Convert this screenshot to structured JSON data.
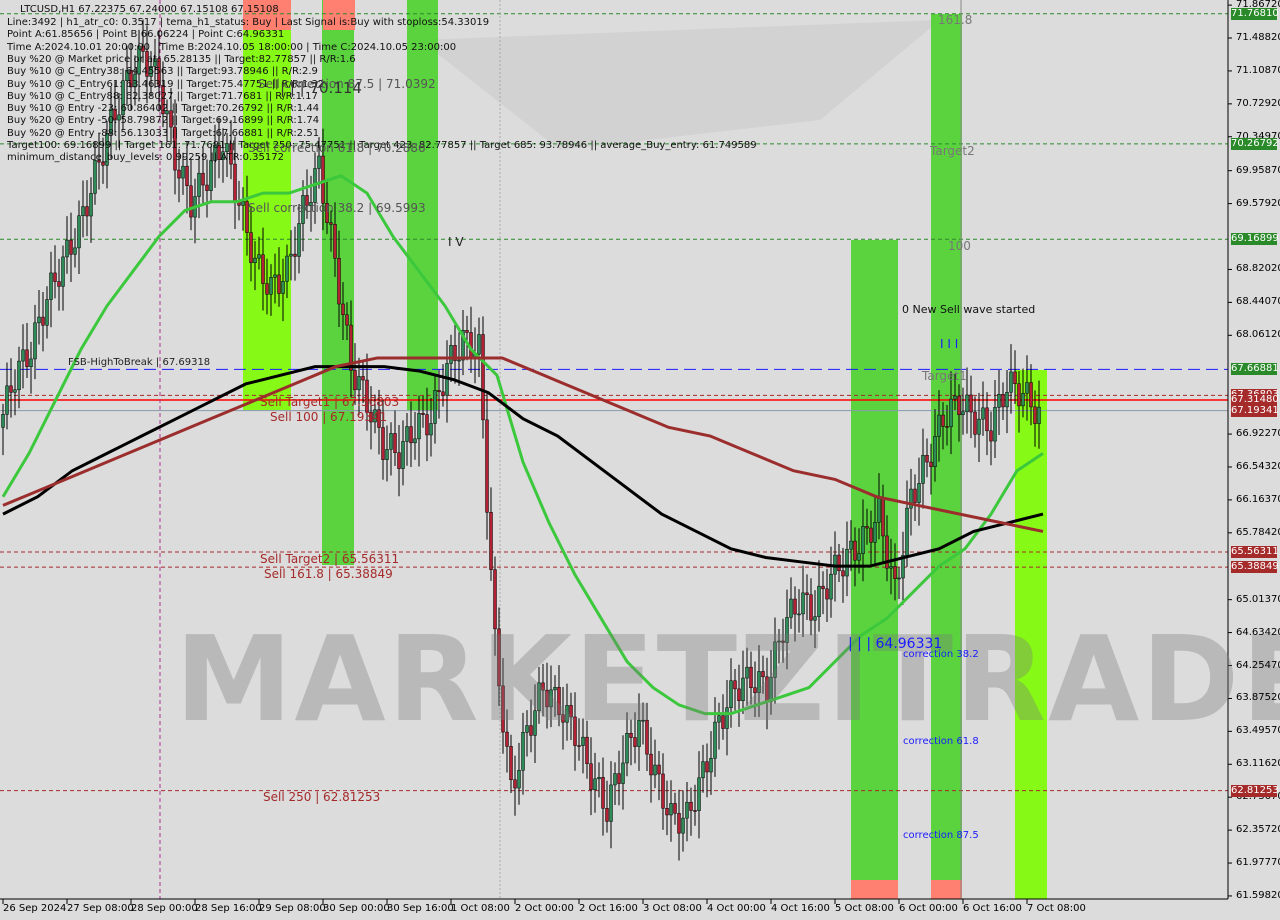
{
  "header": {
    "title": "LTCUSD,H1  67.22375 67.24000 67.15108 67.15108",
    "lines": [
      "Line:3492 | h1_atr_c0: 0.3517 | tema_h1_status: Buy | Last Signal is:Buy with stoploss:54.33019",
      "Point A:61.85656 | Point B:66.06224 | Point C:64.96331",
      "Time A:2024.10.01 20:00:00 | Time B:2024.10.05 18:00:00 | Time C:2024.10.05 23:00:00",
      "Buy %20 @ Market price or at: 65.28135 || Target:82.77857 || R/R:1.6",
      "Buy %10 @ C_Entry38: 64.45563 || Target:93.78946 || R/R:2.9",
      "Buy %10 @ C_Entry61: 63.46319 || Target:75.47751 || R/R:1.32",
      "Buy %10 @ C_Entry88: 62.38027 || Target:71.7681 || R/R:1.17",
      "Buy %10 @ Entry -23: 60.86402 || Target:70.26792 || R/R:1.44",
      "Buy %20 @ Entry -50: 58.79872 || Target:69.16899 || R/R:1.74",
      "Buy %20 @ Entry -88: 56.13033 || Target:67.66881 || R/R:2.51",
      "Target100: 69.16899 || Target 161: 71.7681 || Target 250: 75.47751 || Target 423: 82.77857 || Target 685: 93.78946 || average_Buy_entry: 61.749589",
      "minimum_distance_buy_levels: 0.99259 || ATR:0.35172"
    ]
  },
  "annotations": {
    "sell_corr_875": "Sell correction 87.5 | 71.0392",
    "wave_iii_top": "| | | 70.114",
    "sell_corr_618": "Sell correction 61.8 | 70.2886",
    "sell_corr_382": "Sell correction 38.2 | 69.5993",
    "wave_iv": "I V",
    "fsb": "FSB-HighToBreak | 67.69318",
    "sell_target1": "Sell Target1 | 67.36803",
    "sell_100": "Sell 100 | 67.19341",
    "sell_target2": "Sell Target2 | 65.56311",
    "sell_1618": "Sell 161.8 | 65.38849",
    "sell_250": "Sell 250 | 62.81253",
    "lvl_1618": "161.8",
    "target2": "Target2",
    "lvl_100": "100",
    "new_sell_wave": "0 New Sell wave started",
    "wave_iii": "I I I",
    "target1": "Target1",
    "wave_iii_low": "| | | 64.96331",
    "corr_382": "correction 38.2",
    "corr_618": "correction 61.8",
    "corr_875": "correction 87.5",
    "watermark": "MARKETZITRADE"
  },
  "colors": {
    "background": "#dcdcdc",
    "bull_candle": "#2e8b57",
    "bear_candle": "#b22234",
    "fast_ma": "#3cc83c",
    "slow_ma": "#000000",
    "long_ma": "#9b2d2d",
    "zone_green": "#4cd12e",
    "zone_lime": "#7cfc00",
    "zone_red": "#ff8070",
    "tag_green": "#2a8a2a",
    "tag_red": "#a52a2a"
  },
  "chart_data": {
    "type": "candlestick",
    "symbol": "LTCUSD",
    "timeframe": "H1",
    "ylim": [
      61.5982,
      71.8672
    ],
    "y_ticks": [
      "71.86720",
      "71.48820",
      "71.10870",
      "70.72920",
      "70.34970",
      "69.95870",
      "69.57920",
      "68.82020",
      "68.44070",
      "68.06120",
      "66.92270",
      "66.54320",
      "66.16370",
      "65.78420",
      "65.01370",
      "64.63420",
      "64.25470",
      "63.87520",
      "63.49570",
      "63.11620",
      "62.73670",
      "62.35720",
      "61.97770",
      "61.59820"
    ],
    "price_tags": [
      {
        "value": "71.76810",
        "color": "green"
      },
      {
        "value": "70.26792",
        "color": "green"
      },
      {
        "value": "69.16899",
        "color": "green"
      },
      {
        "value": "67.66881",
        "color": "green"
      },
      {
        "value": "67.36803",
        "color": "red"
      },
      {
        "value": "67.31480",
        "color": "red"
      },
      {
        "value": "67.19341",
        "color": "red"
      },
      {
        "value": "65.56311",
        "color": "red"
      },
      {
        "value": "65.38849",
        "color": "red"
      },
      {
        "value": "62.81253",
        "color": "red"
      }
    ],
    "x_ticks": [
      "26 Sep 2024",
      "27 Sep 08:00",
      "28 Sep 00:00",
      "28 Sep 16:00",
      "29 Sep 08:00",
      "30 Sep 00:00",
      "30 Sep 16:00",
      "1 Oct 08:00",
      "2 Oct 00:00",
      "2 Oct 16:00",
      "3 Oct 08:00",
      "4 Oct 00:00",
      "4 Oct 16:00",
      "5 Oct 08:00",
      "6 Oct 00:00",
      "6 Oct 16:00",
      "7 Oct 08:00"
    ],
    "closes_every_4h": [
      67.0,
      67.6,
      67.9,
      68.5,
      68.9,
      69.3,
      69.9,
      70.5,
      71.0,
      71.3,
      71.0,
      70.1,
      69.6,
      69.9,
      70.3,
      69.6,
      68.9,
      68.6,
      68.8,
      69.5,
      70.0,
      68.9,
      67.7,
      67.3,
      66.8,
      66.7,
      67.0,
      67.1,
      67.7,
      68.0,
      67.9,
      64.5,
      62.8,
      63.5,
      64.0,
      63.8,
      63.5,
      63.0,
      62.6,
      63.2,
      63.6,
      63.0,
      62.5,
      62.5,
      63.0,
      63.6,
      64.0,
      64.1,
      64.0,
      64.7,
      65.0,
      64.9,
      65.3,
      65.5,
      65.7,
      66.0,
      65.1,
      66.2,
      66.6,
      67.1,
      67.3,
      67.1,
      67.0,
      67.5,
      67.4,
      67.15
    ],
    "series": [
      {
        "values_every_4h": [
          66.2,
          66.7,
          67.3,
          67.9,
          68.4,
          68.8,
          69.2,
          69.5,
          69.6,
          69.6,
          69.7,
          69.7,
          69.8,
          69.9,
          69.7,
          69.2,
          68.8,
          68.4,
          67.9,
          67.6,
          66.6,
          65.9,
          65.3,
          64.8,
          64.3,
          64.0,
          63.8,
          63.7,
          63.7,
          63.8,
          63.9,
          64.0,
          64.3,
          64.6,
          64.8,
          65.1,
          65.4,
          65.6,
          66.0,
          66.5,
          66.7
        ]
      },
      {
        "values_every_4h": [
          66.0,
          66.2,
          66.5,
          66.7,
          66.9,
          67.1,
          67.3,
          67.5,
          67.6,
          67.7,
          67.7,
          67.7,
          67.65,
          67.55,
          67.4,
          67.1,
          66.9,
          66.6,
          66.3,
          66.0,
          65.8,
          65.6,
          65.5,
          65.45,
          65.4,
          65.4,
          65.5,
          65.6,
          65.8,
          65.9,
          66.0
        ]
      },
      {
        "values_every_4h": [
          66.1,
          66.3,
          66.5,
          66.7,
          66.9,
          67.1,
          67.3,
          67.5,
          67.7,
          67.8,
          67.8,
          67.8,
          67.8,
          67.6,
          67.4,
          67.2,
          67.0,
          66.9,
          66.7,
          66.5,
          66.4,
          66.2,
          66.1,
          66.0,
          65.9,
          65.8
        ]
      }
    ],
    "levels": [
      71.7681,
      70.26792,
      69.16899,
      67.66881,
      67.36803,
      67.3148,
      67.19341,
      65.56311,
      65.38849,
      62.81253
    ]
  }
}
